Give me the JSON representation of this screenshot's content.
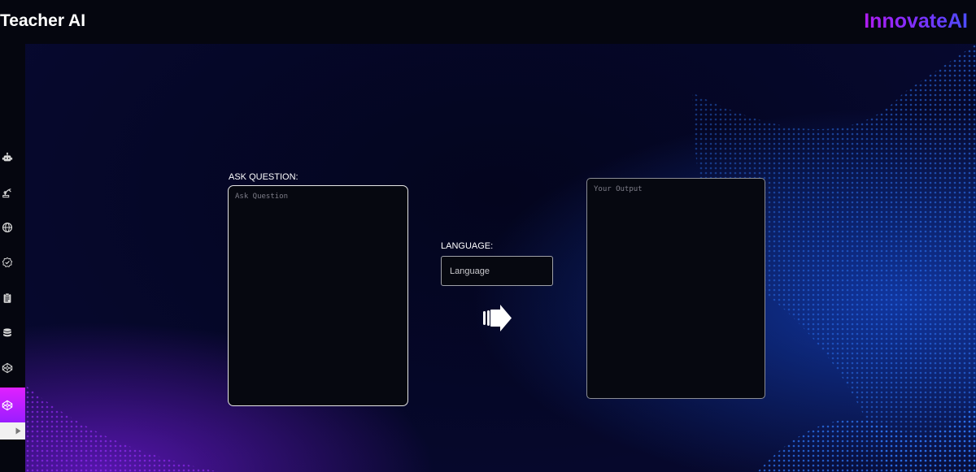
{
  "header": {
    "app_title": "Teacher AI",
    "brand": "InnovateAI"
  },
  "sidebar": {
    "items": [
      {
        "icon": "robot-icon"
      },
      {
        "icon": "robot-arm-icon"
      },
      {
        "icon": "globe-icon"
      },
      {
        "icon": "badge-check-icon"
      },
      {
        "icon": "clipboard-icon"
      },
      {
        "icon": "database-icon"
      },
      {
        "icon": "codepen-icon"
      },
      {
        "icon": "codepen-icon",
        "active": true
      }
    ],
    "toggle_icon": "caret-right-icon"
  },
  "form": {
    "question_label": "ASK QUESTION:",
    "question_placeholder": "Ask Question",
    "language_label": "LANGUAGE:",
    "language_placeholder": "Language",
    "output_placeholder": "Your Output",
    "submit_icon": "hand-point-right-icon"
  },
  "colors": {
    "background": "#05060f",
    "main_background": "#050728",
    "brand_gradient_start": "#b01cf0",
    "brand_gradient_end": "#4d4dff",
    "active_sidebar": "#e021ff",
    "wave_blue": "#1f6dff",
    "wave_purple": "#8a1dff"
  }
}
